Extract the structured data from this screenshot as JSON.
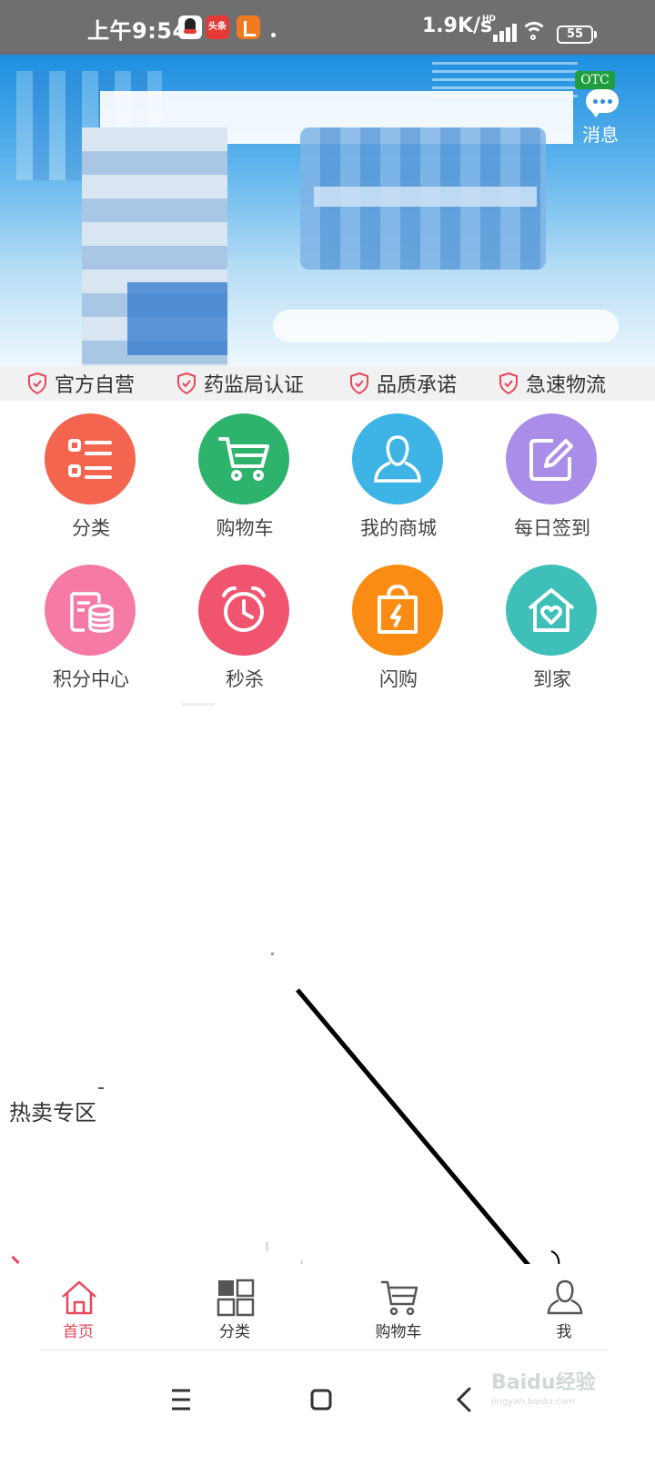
{
  "status_bar": {
    "time": "上午9:54",
    "app_icons": [
      "qq-icon",
      "toutiao-icon",
      "orange-app-icon"
    ],
    "toutiao_text": "头条",
    "speed": "1.9K/s",
    "signal_tag": "HD",
    "battery": "55"
  },
  "banner": {
    "badge": "OTC",
    "message_label": "消息"
  },
  "trust_bar": {
    "items": [
      "官方自营",
      "药监局认证",
      "品质承诺",
      "急速物流"
    ]
  },
  "feature_grid": {
    "items": [
      {
        "label": "分类",
        "icon": "list-icon",
        "color": "#f3654f"
      },
      {
        "label": "购物车",
        "icon": "cart-icon",
        "color": "#2db36b"
      },
      {
        "label": "我的商城",
        "icon": "user-icon",
        "color": "#3eb3e6"
      },
      {
        "label": "每日签到",
        "icon": "edit-icon",
        "color": "#a98de8"
      },
      {
        "label": "积分中心",
        "icon": "coins-icon",
        "color": "#f57ba6"
      },
      {
        "label": "秒杀",
        "icon": "alarm-clock-icon",
        "color": "#f0546f"
      },
      {
        "label": "闪购",
        "icon": "shopping-bag-icon",
        "color": "#fb8c13"
      },
      {
        "label": "到家",
        "icon": "home-heart-icon",
        "color": "#3ebfb8"
      }
    ]
  },
  "hot_section": {
    "title": "热卖专区"
  },
  "tab_bar": {
    "tabs": [
      {
        "label": "首页",
        "icon": "home-icon",
        "active": true
      },
      {
        "label": "分类",
        "icon": "category-grid-icon",
        "active": false
      },
      {
        "label": "购物车",
        "icon": "cart-icon",
        "active": false
      },
      {
        "label": "我",
        "icon": "profile-icon",
        "active": false
      }
    ],
    "active_color": "#e8465a"
  },
  "watermark": {
    "text": "Baidu经验",
    "sub": "jingyan.baidu.com"
  }
}
